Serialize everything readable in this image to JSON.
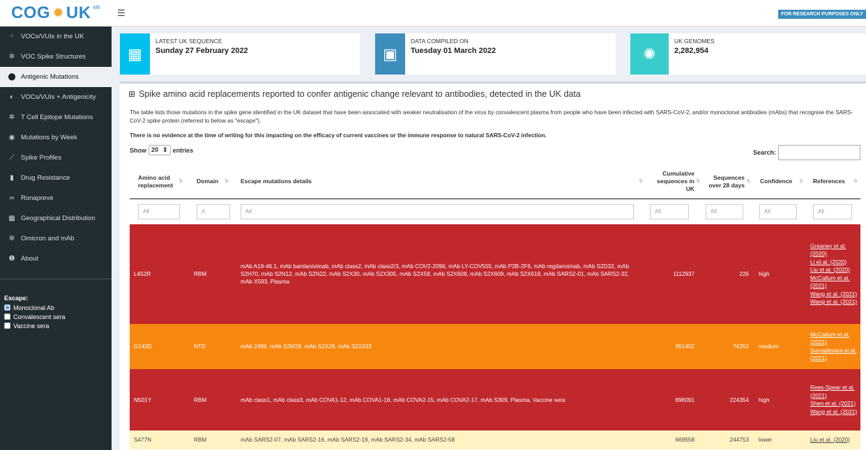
{
  "header": {
    "logo_text": "COG",
    "logo_text2": "UK",
    "logo_sup": "ME",
    "menu_icon": "hamburger-icon",
    "badge": "FOR RESEARCH PURPOSES ONLY"
  },
  "sidebar": {
    "items": [
      {
        "label": "VOCs/VUIs in the UK",
        "icon": "dots-icon",
        "glyph": "⁘",
        "active": false
      },
      {
        "label": "VOC Spike Structures",
        "icon": "virus-icon",
        "glyph": "✲",
        "active": false
      },
      {
        "label": "Antigenic Mutations",
        "icon": "shield-icon",
        "glyph": "⬤",
        "active": true
      },
      {
        "label": "VOCs/VUIs + Antigenicity",
        "icon": "circle-icon",
        "glyph": "◐",
        "active": false
      },
      {
        "label": "T Cell Epitope Mutations",
        "icon": "virus-icon",
        "glyph": "✲",
        "active": false
      },
      {
        "label": "Mutations by Week",
        "icon": "eye-icon",
        "glyph": "◉",
        "active": false
      },
      {
        "label": "Spike Profiles",
        "icon": "line-chart-icon",
        "glyph": "⟋",
        "active": false
      },
      {
        "label": "Drug Resistance",
        "icon": "flask-icon",
        "glyph": "▮",
        "active": false
      },
      {
        "label": "Ronapreve",
        "icon": "pills-icon",
        "glyph": "∞",
        "active": false
      },
      {
        "label": "Geographical Distribution",
        "icon": "map-icon",
        "glyph": "▦",
        "active": false
      },
      {
        "label": "Omicron and mAb",
        "icon": "virus-icon",
        "glyph": "✲",
        "active": false
      },
      {
        "label": "About",
        "icon": "info-icon",
        "glyph": "❶",
        "active": false
      }
    ],
    "escape_title": "Escape:",
    "escape_options": [
      {
        "label": "Monoclonal Ab",
        "checked": true
      },
      {
        "label": "Convalescent sera",
        "checked": false
      },
      {
        "label": "Vaccine sera",
        "checked": false
      }
    ]
  },
  "info_boxes": [
    {
      "label": "LATEST UK SEQUENCE",
      "value": "Sunday 27 February 2022",
      "icon": "calendar-icon",
      "color": "#00c0ef"
    },
    {
      "label": "DATA COMPILED ON",
      "value": "Tuesday 01 March 2022",
      "icon": "calendar-icon",
      "color": "#3c8dbc"
    },
    {
      "label": "UK GENOMES",
      "value": "2,282,954",
      "icon": "virus-icon",
      "color": "#39cccc"
    }
  ],
  "panel": {
    "title": "Spike amino acid replacements reported to confer antigenic change relevant to antibodies, detected in the UK data",
    "description": "The table lists those mutations in the spike gene identified in the UK dataset that have been associated with weaker neutralisation of the virus by convalescent plasma from people who have been infected with SARS-CoV-2, and/or monoclonal antibodies (mAbs) that recognise the SARS-CoV-2 spike protein (referred to below as \"escape\").",
    "note": "There is no evidence at the time of writing for this impacting on the efficacy of current vaccines or the immune response to natural SARS-CoV-2 infection.",
    "show_label": "Show",
    "entries_value": "20",
    "entries_label": "entries",
    "search_label": "Search:"
  },
  "table": {
    "headers": [
      "Amino acid replacement",
      "Domain",
      "Escape mutations details",
      "Cumulative sequences in UK",
      "Sequences over 28 days",
      "Confidence",
      "References"
    ],
    "filter_placeholders": [
      "All",
      "A",
      "All",
      "All",
      "All",
      "All",
      "All"
    ],
    "rows": [
      {
        "aa": "L452R",
        "domain": "RBM",
        "details": "mAb A19-46.1, mAb bamlanivimab, mAb class2, mAb class2/3, mAb COV2-2096, mAb LY-COV555, mAb P2B-2F6, mAb regdanvimab, mAb S2D32, mAb S2H70, mAb S2N12, mAb S2N22, mAb S2X30, mAb S2X305, mAb S2X58, mAb S2X608, mAb S2X609, mAb S2X619, mAb SARS2-01, mAb SARS2-32, mAb X593, Plasma",
        "cumulative": "1112937",
        "recent": "226",
        "confidence": "high",
        "refs": [
          "Greaney et al. (2020)",
          "Li et al. (2020)",
          "Liu et al. (2020)",
          "McCallum et al. (2021)",
          "Wang et al. (2021)",
          "Wang et al. (2021)"
        ],
        "color": "#c0282c"
      },
      {
        "aa": "G142D",
        "domain": "NTD",
        "details": "mAb 2489, mAb S2M28, mAb S2X28, mAb S2X333",
        "cumulative": "951402",
        "recent": "74252",
        "confidence": "medium",
        "refs": [
          "McCallum et al. (2021)",
          "Suryadevara et al. (2021)"
        ],
        "color": "#f7870f"
      },
      {
        "aa": "N501Y",
        "domain": "RBM",
        "details": "mAb class1, mAb class3, mAb COVA1-12, mAb COVA1-18, mAb COVA2-15, mAb COVA2-17, mAb S309, Plasma, Vaccine sera",
        "cumulative": "896091",
        "recent": "224354",
        "confidence": "high",
        "refs": [
          "Rees-Spear et al. (2021)",
          "Shen et al. (2021)",
          "Wang et al. (2021)"
        ],
        "color": "#c0282c"
      },
      {
        "aa": "S477N",
        "domain": "RBM",
        "details": "mAb SARS2-07, mAb SARS2-16, mAb SARS2-19, mAb SARS2-34, mAb SARS2-58",
        "cumulative": "669558",
        "recent": "244753",
        "confidence": "lower",
        "refs": [
          "Liu et al. (2020)"
        ],
        "color": "#fff3c4"
      }
    ]
  }
}
